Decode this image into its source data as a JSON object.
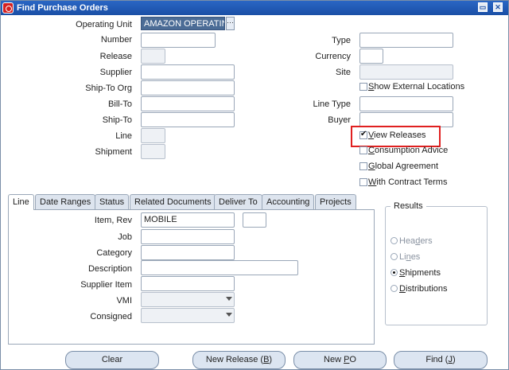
{
  "window": {
    "title": "Find Purchase Orders",
    "minimize_glyph": "▭",
    "close_glyph": "✕"
  },
  "header_left": {
    "operating_unit_label": "Operating Unit",
    "operating_unit_value": "AMAZON OPERATIN",
    "lov_glyph": "···",
    "number_label": "Number",
    "release_label": "Release",
    "supplier_label": "Supplier",
    "ship_to_org_label": "Ship-To Org",
    "bill_to_label": "Bill-To",
    "ship_to_label": "Ship-To",
    "line_label": "Line",
    "shipment_label": "Shipment"
  },
  "header_right": {
    "type_label": "Type",
    "currency_label": "Currency",
    "site_label": "Site",
    "show_external_label": "Show External Locations",
    "line_type_label": "Line Type",
    "buyer_label": "Buyer"
  },
  "checkboxes": [
    {
      "label_pre": "",
      "label_u": "V",
      "label_post": "iew Releases",
      "checked": true
    },
    {
      "label_pre": "",
      "label_u": "C",
      "label_post": "onsumption Advice",
      "checked": false
    },
    {
      "label_pre": "",
      "label_u": "G",
      "label_post": "lobal Agreement",
      "checked": false
    },
    {
      "label_pre": "",
      "label_u": "W",
      "label_post": "ith Contract Terms",
      "checked": false
    }
  ],
  "show_external_checkbox": {
    "label_pre": "",
    "label_u": "S",
    "label_post": "how External Locations",
    "checked": false
  },
  "tabs": [
    {
      "label": "Line",
      "active": true
    },
    {
      "label": "Date Ranges",
      "active": false
    },
    {
      "label": "Status",
      "active": false
    },
    {
      "label": "Related Documents",
      "active": false
    },
    {
      "label": "Deliver To",
      "active": false
    },
    {
      "label": "Accounting",
      "active": false
    },
    {
      "label": "Projects",
      "active": false
    }
  ],
  "line_tab": {
    "item_rev_label": "Item, Rev",
    "item_value": "MOBILE",
    "job_label": "Job",
    "category_label": "Category",
    "description_label": "Description",
    "supplier_item_label": "Supplier Item",
    "vmi_label": "VMI",
    "consigned_label": "Consigned"
  },
  "results": {
    "title": "Results",
    "options": [
      {
        "pre": "Hea",
        "u": "d",
        "post": "ers",
        "selected": false,
        "enabled": false
      },
      {
        "pre": "Li",
        "u": "n",
        "post": "es",
        "selected": false,
        "enabled": false
      },
      {
        "pre": "",
        "u": "S",
        "post": "hipments",
        "selected": true,
        "enabled": true
      },
      {
        "pre": "",
        "u": "D",
        "post": "istributions",
        "selected": false,
        "enabled": true
      }
    ]
  },
  "buttons": {
    "clear": "Clear",
    "new_release_pre": "New Release (",
    "new_release_u": "B",
    "new_release_post": ")",
    "new_po_pre": "New ",
    "new_po_u": "P",
    "new_po_post": "O",
    "find_pre": "Find (",
    "find_u": "J",
    "find_post": ")"
  },
  "colors": {
    "title_bar": "#1a4fa6",
    "selected_value_bg": "#4b6c96",
    "highlight": "#e02020"
  }
}
